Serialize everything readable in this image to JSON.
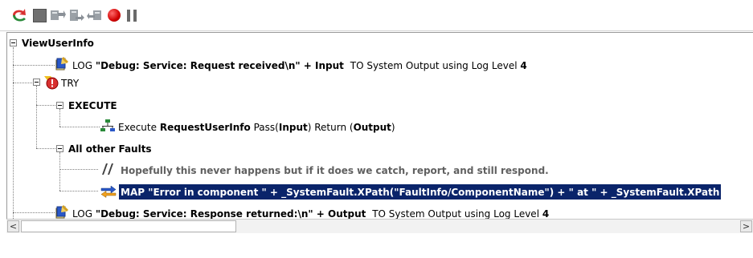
{
  "toolbar": {
    "buttons": [
      {
        "name": "run-icon"
      },
      {
        "name": "stop-icon"
      },
      {
        "name": "step-into-icon"
      },
      {
        "name": "step-over-icon"
      },
      {
        "name": "step-out-icon"
      },
      {
        "name": "breakpoint-icon"
      },
      {
        "name": "pause-icon"
      }
    ]
  },
  "tree": {
    "root": "ViewUserInfo",
    "log1": {
      "keyword": "LOG",
      "message": "\"Debug: Service: Request received\\n\" + Input",
      "suffix": "TO System Output using Log Level",
      "level": "4"
    },
    "try": "TRY",
    "execute_group": "EXECUTE",
    "execute": {
      "keyword": "Execute",
      "service": "RequestUserInfo",
      "pass_label": "Pass(",
      "pass_value": "Input",
      "return_label": ") Return (",
      "return_value": "Output",
      "close": ")"
    },
    "faults_group": "All other Faults",
    "comment": "Hopefully this never happens but if it does we catch, report, and still respond.",
    "map": "MAP \"Error in component \" + _SystemFault.XPath(\"FaultInfo/ComponentName\") + \" at \" + _SystemFault.XPath",
    "log2": {
      "keyword": "LOG",
      "message": "\"Debug: Service: Response returned:\\n\" + Output",
      "suffix": "TO System Output using Log Level",
      "level": "4"
    }
  },
  "scrollbar": {
    "left_arrow": "<",
    "right_arrow": ">"
  }
}
